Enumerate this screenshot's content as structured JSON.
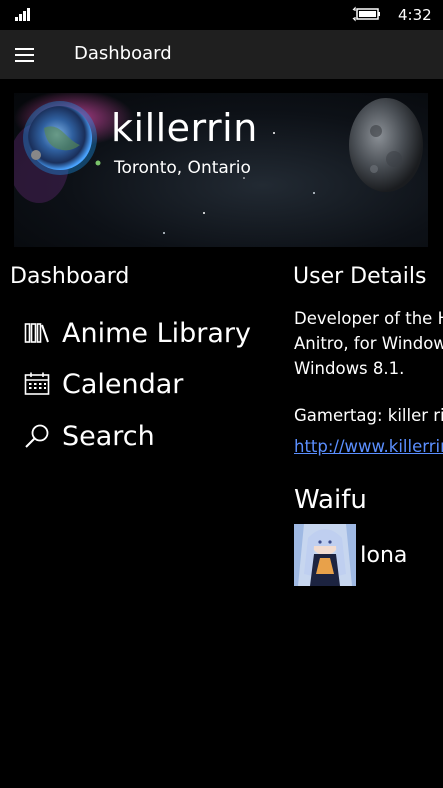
{
  "status_bar": {
    "time": "4:32",
    "signal_icon": "signal-bars-icon",
    "battery_icon": "battery-charging-icon"
  },
  "app_bar": {
    "title": "Dashboard",
    "menu_icon": "hamburger-menu-icon"
  },
  "profile": {
    "username": "killerrin",
    "location": "Toronto, Ontario"
  },
  "dashboard": {
    "heading": "Dashboard",
    "items": [
      {
        "label": "Anime Library",
        "icon": "library-icon"
      },
      {
        "label": "Calendar",
        "icon": "calendar-icon"
      },
      {
        "label": "Search",
        "icon": "search-icon"
      }
    ]
  },
  "user_details": {
    "heading": "User Details",
    "bio_lines": [
      "Developer of the H",
      "Anitro, for Window",
      "Windows 8.1."
    ],
    "gamertag": "Gamertag: killer rin",
    "link": "http://www.killerrin"
  },
  "waifu": {
    "heading": "Waifu",
    "name": "Iona"
  },
  "colors": {
    "background": "#000000",
    "app_bar": "#1f1f1f",
    "link": "#5b8fff"
  }
}
